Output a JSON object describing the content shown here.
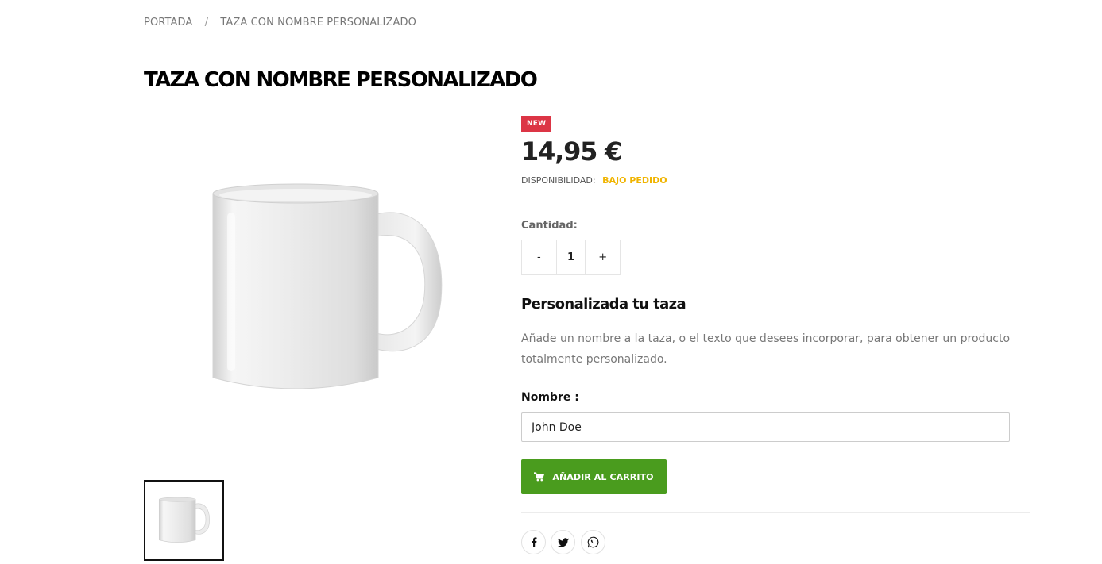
{
  "breadcrumb": {
    "home": "PORTADA",
    "separator": "/",
    "current": "TAZA CON NOMBRE PERSONALIZADO"
  },
  "product": {
    "title": "TAZA CON NOMBRE PERSONALIZADO",
    "badge": "NEW",
    "price": "14,95 €",
    "availability_label": "DISPONIBILIDAD:",
    "availability_value": "BAJO PEDIDO"
  },
  "quantity": {
    "label": "Cantidad:",
    "minus": "-",
    "value": "1",
    "plus": "+"
  },
  "customization": {
    "title": "Personalizada tu taza",
    "description": "Añade un nombre a la taza, o el texto que desees incorporar, para obtener un producto totalmente personalizado.",
    "name_label": "Nombre :",
    "name_value": "John Doe"
  },
  "cart": {
    "add_label": "AÑADIR AL CARRITO",
    "icon": "cart-icon"
  },
  "share": {
    "icons": [
      "facebook-icon",
      "twitter-icon",
      "whatsapp-icon"
    ]
  },
  "colors": {
    "badge": "#dc3545",
    "availability": "#f0b400",
    "cart_button": "#4a9c1e"
  }
}
